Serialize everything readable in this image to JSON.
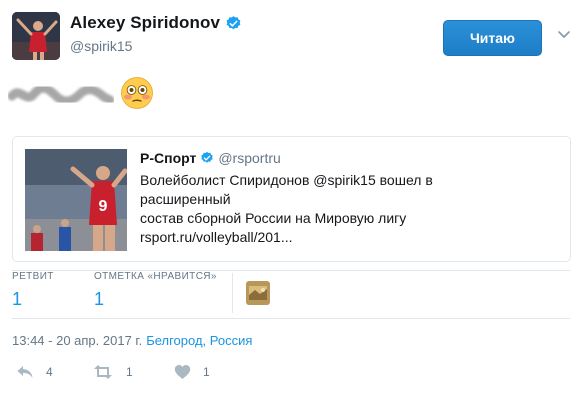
{
  "user": {
    "name": "Alexey Spiridonov",
    "handle": "@spirik15",
    "follow_label": "Читаю"
  },
  "tweet": {
    "emoji": "flushed-face"
  },
  "quote": {
    "name": "Р-Спорт",
    "handle": "@rsportru",
    "text_lines": [
      "Волейболист Спиридонов @spirik15 вошел в расширенный",
      "состав сборной России на Мировую лигу",
      "rsport.ru/volleyball/201..."
    ],
    "jersey_number": "9"
  },
  "stats": {
    "retweets_label": "РЕТВИТ",
    "retweets_value": "1",
    "likes_label": "ОТМЕТКА «НРАВИТСЯ»",
    "likes_value": "1"
  },
  "meta": {
    "timestamp": "13:44 - 20 апр. 2017 г.",
    "location": "Белгород, Россия"
  },
  "actions": {
    "reply_count": "4",
    "retweet_count": "1",
    "like_count": "1"
  },
  "colors": {
    "accent": "#1b95e0",
    "follow_button": "#1d7ec7",
    "border": "#e1e8ed",
    "muted_text": "#657786"
  }
}
